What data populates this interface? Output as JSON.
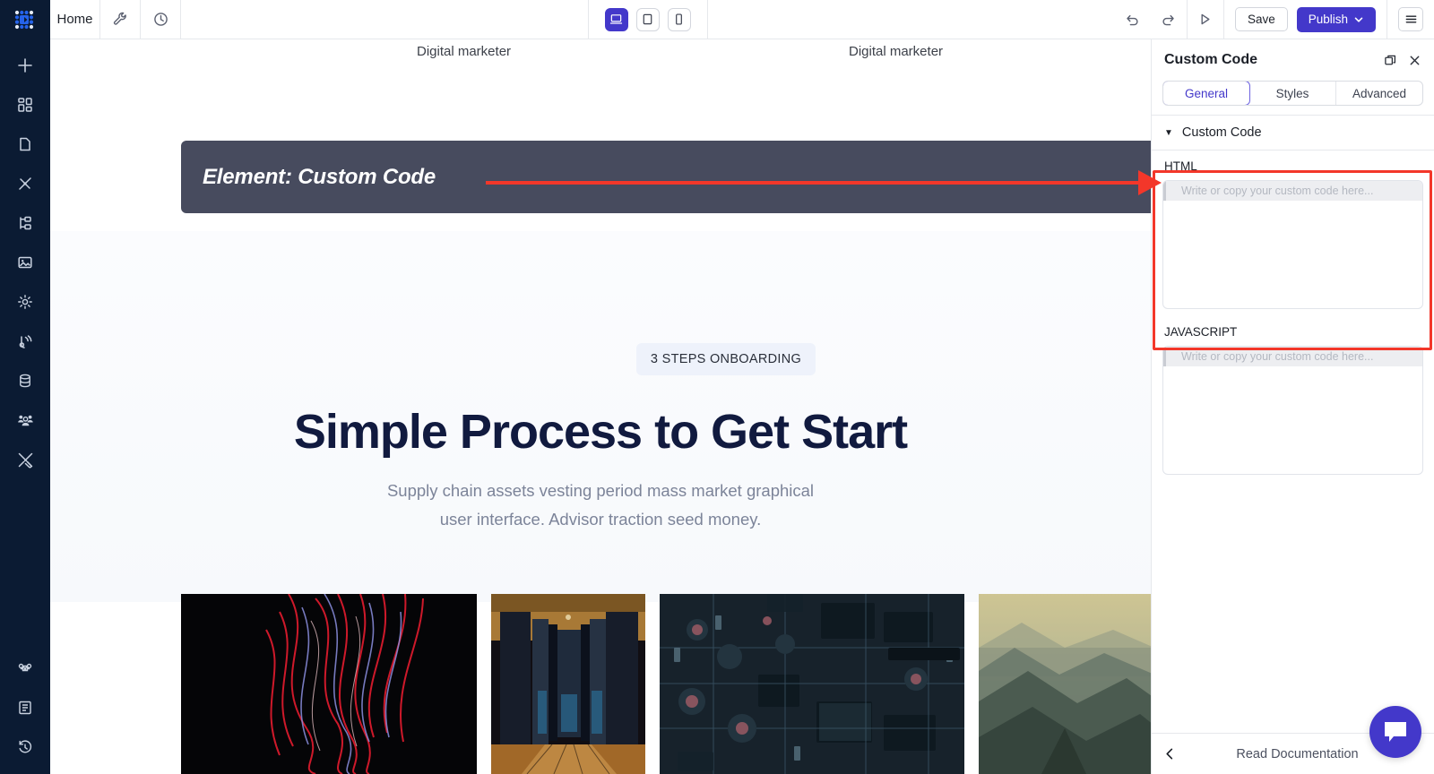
{
  "app": {
    "logo_icon": "grid-dots-logo",
    "brand_color": "#4338ca"
  },
  "topbar": {
    "home_label": "Home",
    "tools_icon": "wrench-icon",
    "history_icon": "clock-icon",
    "devices": [
      {
        "name": "desktop",
        "icon": "desktop-icon",
        "active": true
      },
      {
        "name": "tablet",
        "icon": "tablet-icon",
        "active": false
      },
      {
        "name": "mobile",
        "icon": "mobile-icon",
        "active": false
      }
    ],
    "undo_icon": "undo-icon",
    "redo_icon": "redo-icon",
    "preview_icon": "play-triangle-icon",
    "save_label": "Save",
    "publish_label": "Publish",
    "publish_caret_icon": "chevron-down-icon",
    "menu_icon": "hamburger-menu-icon"
  },
  "sidebar": {
    "items": [
      {
        "name": "add",
        "icon": "plus-icon"
      },
      {
        "name": "blocks",
        "icon": "blocks-grid-icon"
      },
      {
        "name": "pages",
        "icon": "page-icon"
      },
      {
        "name": "design",
        "icon": "brush-icon"
      },
      {
        "name": "layers",
        "icon": "layers-tree-icon"
      },
      {
        "name": "media",
        "icon": "image-icon"
      },
      {
        "name": "settings",
        "icon": "gear-icon"
      },
      {
        "name": "integrations",
        "icon": "broadcast-icon"
      },
      {
        "name": "database",
        "icon": "database-icon"
      },
      {
        "name": "users",
        "icon": "users-group-icon"
      },
      {
        "name": "tools",
        "icon": "tools-cross-icon"
      }
    ],
    "bottom_items": [
      {
        "name": "shortcuts",
        "icon": "command-key-icon"
      },
      {
        "name": "docs",
        "icon": "book-icon"
      },
      {
        "name": "history",
        "icon": "restore-clock-icon"
      }
    ]
  },
  "canvas": {
    "top_labels": [
      {
        "text": "Digital marketer"
      },
      {
        "text": "Digital marketer"
      }
    ],
    "element_bar": {
      "label": "Element: Custom Code",
      "background": "#474b5e",
      "text_color": "#ffffff"
    },
    "badge": "3 STEPS ONBOARDING",
    "headline": "Simple Process to Get Start",
    "subhead": "Supply chain assets vesting period mass market graphical user interface. Advisor traction seed money.",
    "thumbnails": [
      {
        "name": "red-light-trails-photo"
      },
      {
        "name": "data-center-corridor-photo"
      },
      {
        "name": "circuit-board-photo"
      },
      {
        "name": "mountain-landscape-photo"
      }
    ]
  },
  "annotation": {
    "arrow_color": "#f3372a",
    "highlight_color": "#f3372a",
    "arrow_name": "red-pointer-arrow",
    "highlight_name": "red-highlight-box"
  },
  "panel": {
    "title": "Custom Code",
    "detach_icon": "detach-panel-icon",
    "close_icon": "close-icon",
    "tabs": [
      {
        "label": "General",
        "active": true
      },
      {
        "label": "Styles",
        "active": false
      },
      {
        "label": "Advanced",
        "active": false
      }
    ],
    "accordion": {
      "caret_icon": "caret-down-icon",
      "title": "Custom Code"
    },
    "fields": [
      {
        "label": "HTML",
        "placeholder": "Write or copy your custom code here...",
        "value": ""
      },
      {
        "label": "JAVASCRIPT",
        "placeholder": "Write or copy your custom code here...",
        "value": ""
      }
    ],
    "footer": {
      "back_icon": "chevron-left-icon",
      "doc_label": "Read Documentation"
    },
    "chat_icon": "chat-bubble-icon"
  }
}
